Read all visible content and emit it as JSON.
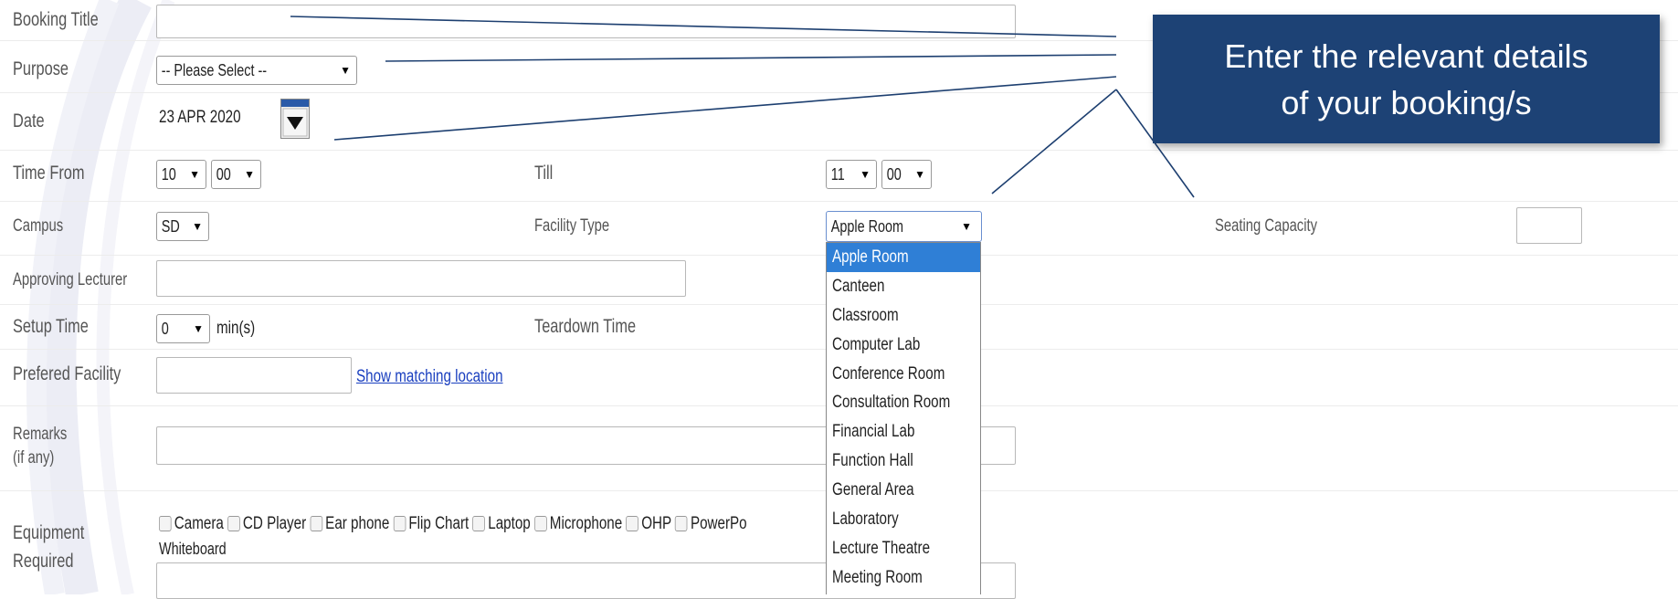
{
  "form": {
    "booking_title": {
      "label": "Booking Title",
      "value": ""
    },
    "purpose": {
      "label": "Purpose",
      "value": "-- Please Select --"
    },
    "date": {
      "label": "Date",
      "value": "23 APR 2020"
    },
    "time_from": {
      "label": "Time From",
      "hour": "10",
      "minute": "00"
    },
    "till": {
      "label": "Till",
      "hour": "11",
      "minute": "00"
    },
    "campus": {
      "label": "Campus",
      "value": "SD"
    },
    "facility_type": {
      "label": "Facility Type",
      "value": "Apple Room"
    },
    "seating_capacity": {
      "label": "Seating Capacity",
      "value": ""
    },
    "approving_lecturer": {
      "label": "Approving Lecturer",
      "value": ""
    },
    "setup_time": {
      "label": "Setup Time",
      "value": "0",
      "unit": "min(s)"
    },
    "teardown_time": {
      "label": "Teardown Time"
    },
    "preferred_facility": {
      "label": "Prefered Facility",
      "value": "",
      "link": "Show matching location"
    },
    "remarks": {
      "label": "Remarks",
      "sublabel": "(if any)",
      "value": ""
    },
    "equipment": {
      "label_line1": "Equipment",
      "label_line2": "Required",
      "items": [
        "Camera",
        "CD Player",
        "Ear phone",
        "Flip Chart",
        "Laptop",
        "Microphone",
        "OHP",
        "PowerPo"
      ],
      "second_line": "Whiteboard"
    }
  },
  "facility_dropdown": {
    "options": [
      "Apple Room",
      "Canteen",
      "Classroom",
      "Computer Lab",
      "Conference Room",
      "Consultation Room",
      "Financial Lab",
      "Function Hall",
      "General Area",
      "Laboratory",
      "Lecture Theatre",
      "Meeting Room"
    ],
    "highlighted": "Apple Room"
  },
  "callout": {
    "line1": "Enter the relevant details",
    "line2": "of your booking/s"
  },
  "colors": {
    "callout_bg": "#1d4275",
    "highlight": "#2f7fd6",
    "link": "#1a3fbf"
  }
}
